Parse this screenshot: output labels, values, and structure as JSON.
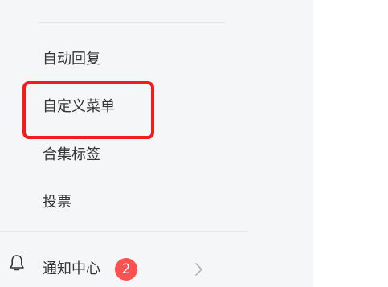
{
  "sidebar": {
    "items": [
      {
        "label": "自动回复"
      },
      {
        "label": "自定义菜单"
      },
      {
        "label": "合集标签"
      },
      {
        "label": "投票"
      }
    ],
    "notice": {
      "label": "通知中心",
      "badge_count": "2",
      "icon": "bell-icon"
    }
  },
  "highlight": {
    "color": "#f21c1c"
  },
  "colors": {
    "badge": "#fa5151",
    "sidebar_bg": "#f5f6f7",
    "text": "#353535"
  }
}
